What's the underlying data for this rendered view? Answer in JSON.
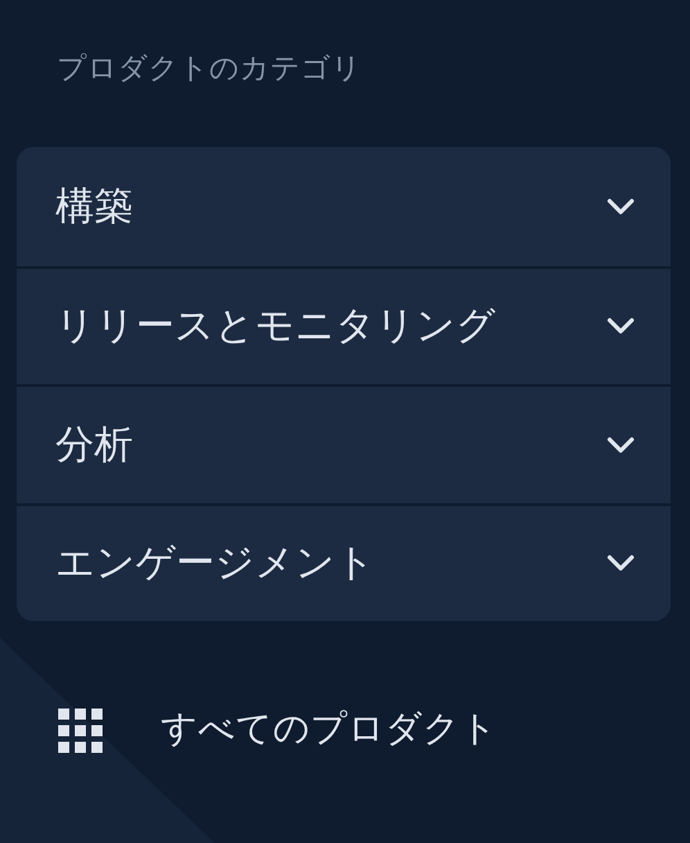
{
  "heading": "プロダクトのカテゴリ",
  "categories": [
    {
      "label": "構築",
      "expanded": false
    },
    {
      "label": "リリースとモニタリング",
      "expanded": false
    },
    {
      "label": "分析",
      "expanded": false
    },
    {
      "label": "エンゲージメント",
      "expanded": false
    }
  ],
  "all_products": {
    "label": "すべてのプロダクト"
  }
}
